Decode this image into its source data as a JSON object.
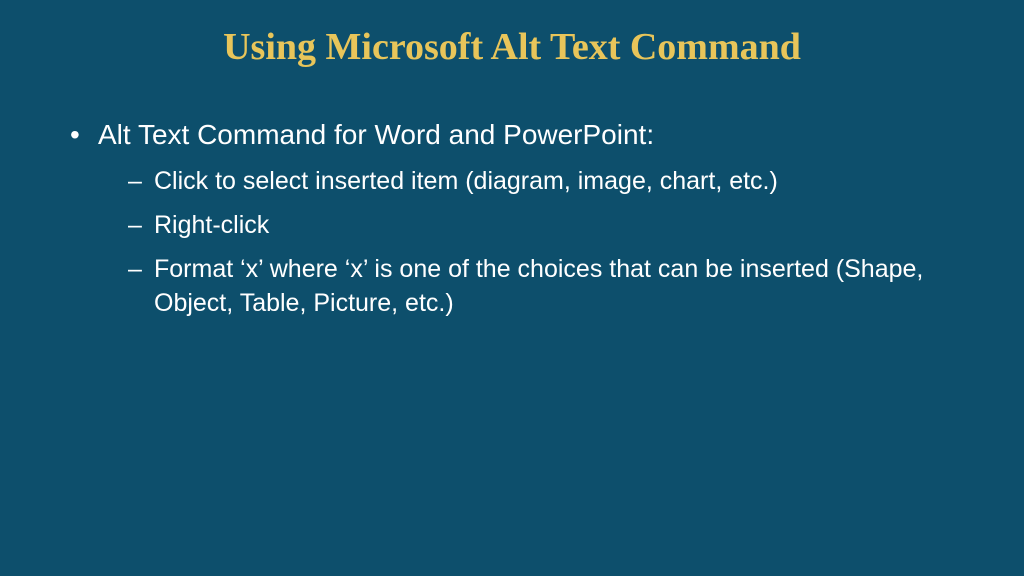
{
  "slide": {
    "title": "Using Microsoft Alt Text Command",
    "bullets": {
      "main": "Alt Text Command for Word and PowerPoint:",
      "sub1": "Click to select inserted item (diagram, image, chart, etc.)",
      "sub2": "Right-click",
      "sub3": "Format ‘x’ where ‘x’ is one of  the choices that can be inserted (Shape, Object, Table, Picture, etc.)"
    }
  }
}
